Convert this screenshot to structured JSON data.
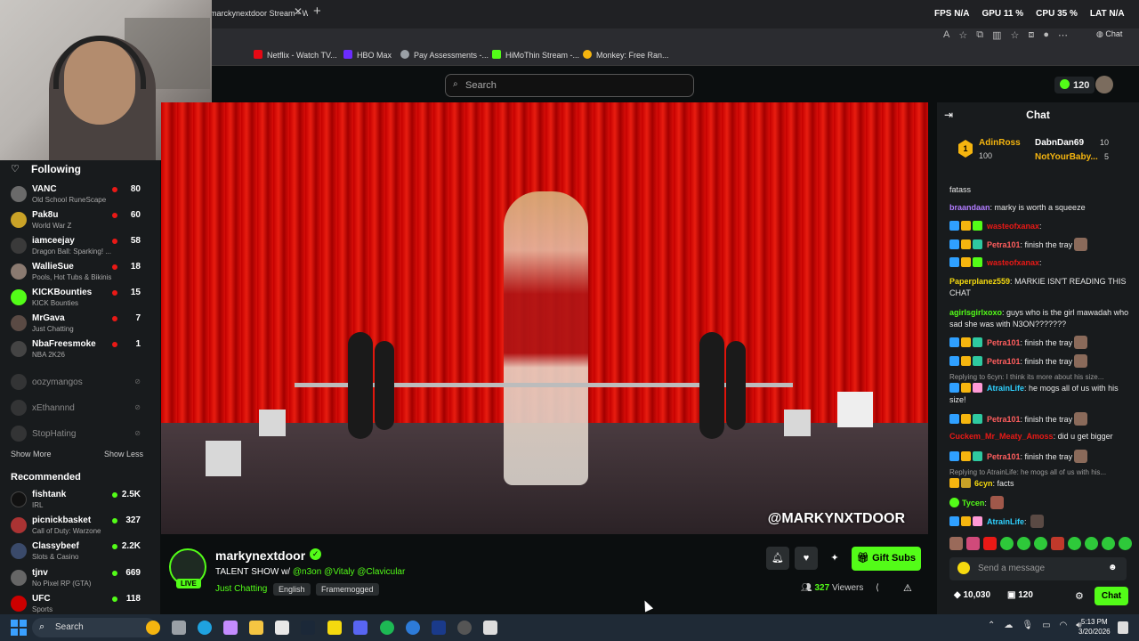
{
  "browser": {
    "tab_title": "marckynextdoor Stream - Watc",
    "overlay": {
      "fps_label": "FPS",
      "fps": "N/A",
      "gpu_label": "GPU",
      "gpu": "11 %",
      "cpu_label": "CPU",
      "cpu": "35 %",
      "lat_label": "LAT",
      "lat": "N/A"
    },
    "copilot_label": "Chat",
    "bookmarks": [
      {
        "label": "Netflix - Watch TV...",
        "color": "#e50914"
      },
      {
        "label": "HBO Max",
        "color": "#6b2cff"
      },
      {
        "label": "Pay Assessments -...",
        "color": "#9aa0a6"
      },
      {
        "label": "HiMoThin Stream -...",
        "color": "#53fc18"
      },
      {
        "label": "Monkey: Free Ran...",
        "color": "#f5b50f"
      }
    ]
  },
  "header": {
    "search_placeholder": "Search",
    "kicks": "120"
  },
  "sidebar": {
    "following_label": "Following",
    "channels": [
      {
        "name": "VANC",
        "game": "Old School RuneScape",
        "viewers": "80"
      },
      {
        "name": "Pak8u",
        "game": "World War Z",
        "viewers": "60"
      },
      {
        "name": "iamceejay",
        "game": "Dragon Ball: Sparking! ...",
        "viewers": "58"
      },
      {
        "name": "WallieSue",
        "game": "Pools, Hot Tubs & Bikinis",
        "viewers": "18"
      },
      {
        "name": "KICKBounties",
        "game": "KICK Bounties",
        "viewers": "15"
      },
      {
        "name": "MrGava",
        "game": "Just Chatting",
        "viewers": "7"
      },
      {
        "name": "NbaFreesmoke",
        "game": "NBA 2K26",
        "viewers": "1"
      }
    ],
    "offline": [
      "oozymangos",
      "xEthannnd",
      "StopHating"
    ],
    "show_more": "Show More",
    "show_less": "Show Less",
    "recommended_label": "Recommended",
    "recommended": [
      {
        "name": "fishtank",
        "game": "IRL",
        "viewers": "2.5K"
      },
      {
        "name": "picnickbasket",
        "game": "Call of Duty: Warzone",
        "viewers": "327"
      },
      {
        "name": "Classybeef",
        "game": "Slots & Casino",
        "viewers": "2.2K"
      },
      {
        "name": "tjnv",
        "game": "No Pixel RP (GTA)",
        "viewers": "669"
      },
      {
        "name": "UFC",
        "game": "Sports",
        "viewers": "118"
      }
    ]
  },
  "video": {
    "watermark": "@MARKYNXTDOOR"
  },
  "stream": {
    "streamer": "markynextdoor",
    "live": "LIVE",
    "title_prefix": "TALENT SHOW w/",
    "title_mentions": "@n3on @Vitaly @Clavicular",
    "category": "Just Chatting",
    "tags": [
      "English",
      "Framemogged"
    ],
    "gift_subs": "Gift Subs",
    "viewers_count": "327",
    "viewers_label": "Viewers"
  },
  "chat": {
    "title": "Chat",
    "leaderboard": [
      {
        "name": "AdinRoss",
        "value": "100"
      },
      {
        "name": "DabnDan69",
        "value": "10"
      },
      {
        "name": "NotYourBaby...",
        "value": "5"
      }
    ],
    "messages": [
      {
        "user": "",
        "text": "fatass",
        "color": "#e8e8e8"
      },
      {
        "user": "braandaan",
        "text": "marky is worth a squeeze",
        "color": "#b17cff"
      },
      {
        "user": "wasteofxanax",
        "text": "",
        "color": "#e91916"
      },
      {
        "user": "Petra101",
        "text": "finish the tray",
        "color": "#ff5e5e"
      },
      {
        "user": "wasteofxanax",
        "text": "",
        "color": "#e91916"
      },
      {
        "user": "Paperplanez559",
        "text": "MARKIE ISN'T READING THIS CHAT",
        "color": "#f5d90f"
      },
      {
        "user": "agirlsgirlxoxo",
        "text": "guys who is the girl mawadah who sad she was with N3ON???????",
        "color": "#53fc18"
      },
      {
        "user": "Petra101",
        "text": "finish the tray",
        "color": "#ff5e5e"
      },
      {
        "user": "Petra101",
        "text": "finish the tray",
        "color": "#ff5e5e"
      },
      {
        "user": "AtrainLife",
        "text": "he mogs all of us with his size!",
        "color": "#2fd1ff",
        "reply": "Replying to 6cyn: I think its more about his size..."
      },
      {
        "user": "Petra101",
        "text": "finish the tray",
        "color": "#ff5e5e"
      },
      {
        "user": "Cuckem_Mr_Meaty_Amoss",
        "text": "did u get bigger",
        "color": "#e91916"
      },
      {
        "user": "Petra101",
        "text": "finish the tray",
        "color": "#ff5e5e"
      },
      {
        "user": "6cyn",
        "text": "facts",
        "color": "#f5d90f",
        "reply": "Replying to AtrainLife: he mogs all of us with his..."
      },
      {
        "user": "Tycen",
        "text": "",
        "color": "#53fc18"
      },
      {
        "user": "AtrainLife",
        "text": "",
        "color": "#2fd1ff"
      }
    ],
    "input_placeholder": "Send a message",
    "points": "10,030",
    "points2": "120",
    "send_label": "Chat"
  },
  "taskbar": {
    "search": "Search",
    "time": "5:13 PM",
    "date": "3/20/2026"
  }
}
